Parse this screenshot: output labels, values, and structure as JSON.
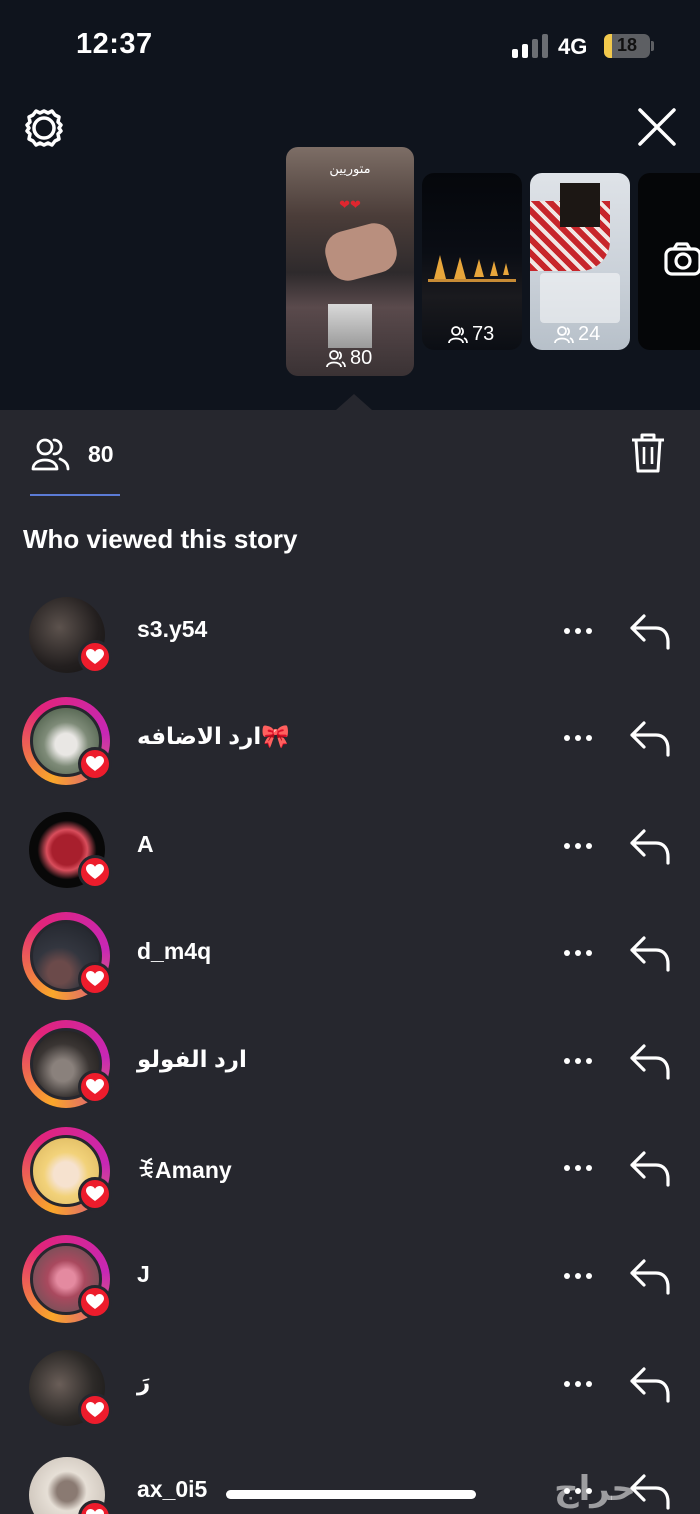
{
  "status_bar": {
    "time": "12:37",
    "network": "4G",
    "battery": "18",
    "battery_level": 0.18
  },
  "stories": [
    {
      "overlay_text": "متوريين",
      "count": "80"
    },
    {
      "count": "73"
    },
    {
      "count": "24"
    }
  ],
  "viewers_tab": {
    "count": "80"
  },
  "section_title": "Who viewed this story",
  "viewers": [
    {
      "username": "s3.y54",
      "ring": false,
      "avatar": "dark-selfie"
    },
    {
      "username": "ارد الاضافه🎀",
      "ring": true,
      "avatar": "blonde-portrait"
    },
    {
      "username": "A",
      "ring": false,
      "avatar": "red-flower"
    },
    {
      "username": "d_m4q",
      "ring": true,
      "avatar": "night-sky"
    },
    {
      "username": "ارد الفولو",
      "ring": true,
      "avatar": "couple-photo"
    },
    {
      "username": "ꉂAmany",
      "ring": true,
      "avatar": "anime-girl"
    },
    {
      "username": "J",
      "ring": true,
      "avatar": "pink-lilies"
    },
    {
      "username": "رَ",
      "ring": false,
      "avatar": "mirror-selfie"
    },
    {
      "username": "ax_0i5",
      "ring": false,
      "avatar": "camera-selfie"
    }
  ],
  "colors": {
    "background": "#0f141d",
    "sheet": "#26272e",
    "heart": "#ed1c2c",
    "tab_underline": "#5b7bd5"
  },
  "watermark": "حراج"
}
